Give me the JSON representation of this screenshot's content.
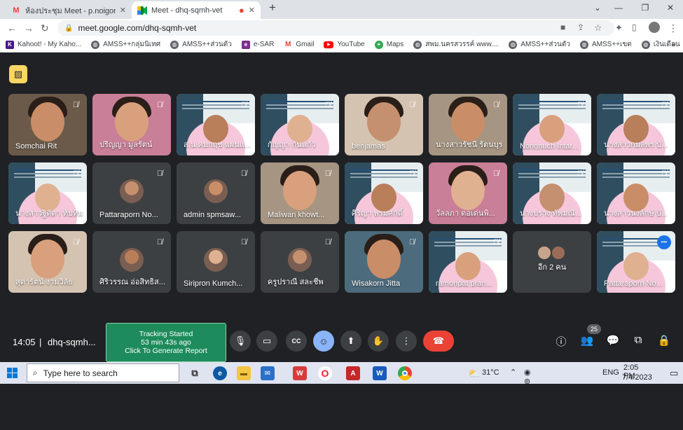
{
  "browser": {
    "tabs": [
      {
        "title": "ห้องประชุม Meet - p.noigor@gma",
        "favicon": "gmail-icon",
        "active": false
      },
      {
        "title": "Meet - dhq-sqmh-vet",
        "favicon": "meet-icon",
        "active": true
      }
    ],
    "new_tab": "+",
    "url": "meet.google.com/dhq-sqmh-vet",
    "bookmarks": [
      {
        "label": "Kahoot! - My Kaho...",
        "icon": "kahoot-icon"
      },
      {
        "label": "AMSS++กลุ่มนิเทศ",
        "icon": "globe-icon"
      },
      {
        "label": "AMSS++ส่วนตัว",
        "icon": "globe-icon"
      },
      {
        "label": "e-SAR",
        "icon": "esar-icon"
      },
      {
        "label": "Gmail",
        "icon": "gmail-icon"
      },
      {
        "label": "YouTube",
        "icon": "youtube-icon"
      },
      {
        "label": "Maps",
        "icon": "maps-icon"
      },
      {
        "label": "สพม.นครสวรรค์ www....",
        "icon": "globe-icon"
      },
      {
        "label": "AMSS++ส่วนตัว",
        "icon": "globe-icon"
      },
      {
        "label": "AMSS++เขต",
        "icon": "globe-icon"
      },
      {
        "label": "เงินเดือน",
        "icon": "globe-icon"
      }
    ]
  },
  "meet": {
    "participants": [
      {
        "name": "Somchai Rit",
        "kind": "camera"
      },
      {
        "name": "ปริญญา มูลรัตน์",
        "kind": "camera"
      },
      {
        "name": "ส.น.คมกฤช แผนแ...",
        "kind": "slide"
      },
      {
        "name": "กัญญา กันแก้ว",
        "kind": "slide"
      },
      {
        "name": "benjamas",
        "kind": "camera"
      },
      {
        "name": "นางสาวรัชนี รัตนบุร",
        "kind": "camera"
      },
      {
        "name": "Nongnuch Intar...",
        "kind": "slide"
      },
      {
        "name": "นางสาวกมลพร บั...",
        "kind": "slide"
      },
      {
        "name": "นางสาวฐิติดา ทับทิม",
        "kind": "slide"
      },
      {
        "name": "Pattaraporn No...",
        "kind": "avatar"
      },
      {
        "name": "admin spmsaw...",
        "kind": "avatar"
      },
      {
        "name": "Maliwan khowt...",
        "kind": "camera"
      },
      {
        "name": "ศิริญา พรมศักดิ์",
        "kind": "slide"
      },
      {
        "name": "วัลลภา ดอเด่นพิ...",
        "kind": "camera"
      },
      {
        "name": "นางปราง ทัพมณี...",
        "kind": "slide"
      },
      {
        "name": "นางสาวนงลักษ์ บั...",
        "kind": "slide"
      },
      {
        "name": "สุดารัตน์ งามวิลัย",
        "kind": "camera"
      },
      {
        "name": "ศิริวรรณ อ่อสิทธิส...",
        "kind": "avatar"
      },
      {
        "name": "Siripron Kumch...",
        "kind": "avatar"
      },
      {
        "name": "ครูปราณี สละชีพ",
        "kind": "avatar"
      },
      {
        "name": "Wisakorn Jitta",
        "kind": "camera"
      },
      {
        "name": "ramonpat pran...",
        "kind": "slide"
      },
      {
        "name": "อีก 2 คน",
        "kind": "more"
      },
      {
        "name": "Pattaraporn No...",
        "kind": "slide"
      }
    ],
    "reactions": [
      "💖",
      "👍",
      "🎉",
      "👏",
      "😂",
      "😮",
      "😢",
      "🤔",
      "👎"
    ],
    "time": "14:05",
    "separator": "|",
    "meeting_code": "dhq-sqmh...",
    "tracking": {
      "line1": "Tracking Started",
      "line2": "53 min 43s ago",
      "line3": "Click To Generate Report"
    },
    "participant_count": "25"
  },
  "taskbar": {
    "search_placeholder": "Type here to search",
    "weather": "31°C",
    "language": "ENG",
    "time": "2:05 PM",
    "date": "7/4/2023"
  },
  "colors": {
    "leave": "#ea4335",
    "accent": "#8ab4f8",
    "tracking": "#1d8b5b",
    "caption": "#fdd663"
  }
}
